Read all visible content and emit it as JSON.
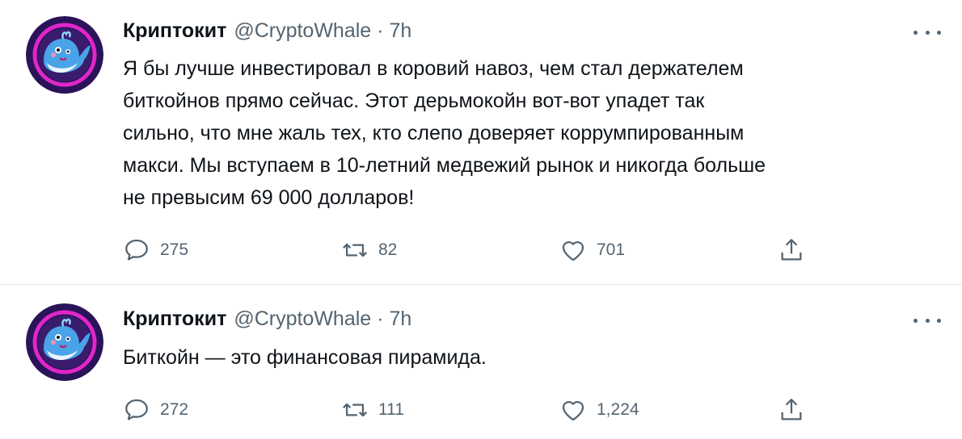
{
  "tweets": [
    {
      "author_name": "Криптокит",
      "handle": "@CryptoWhale",
      "separator": "·",
      "time": "7h",
      "text": "Я бы лучше инвестировал в коровий навоз, чем стал держателем\nбиткойнов прямо сейчас. Этот дерьмокойн вот-вот упадет так\nсильно, что мне жаль тех, кто слепо доверяет коррумпированным\nмакси. Мы вступаем в 10-летний медвежий рынок и никогда больше\nне превысим 69 000 долларов!",
      "replies": "275",
      "retweets": "82",
      "likes": "701"
    },
    {
      "author_name": "Криптокит",
      "handle": "@CryptoWhale",
      "separator": "·",
      "time": "7h",
      "text": "Биткойн — это финансовая пирамида.",
      "replies": "272",
      "retweets": "111",
      "likes": "1,224"
    }
  ],
  "icons": {
    "reply": "reply-icon",
    "retweet": "retweet-icon",
    "like": "like-icon",
    "share": "share-icon",
    "more": "more-icon",
    "avatar": "whale-avatar"
  },
  "colors": {
    "text_primary": "#0f1419",
    "text_secondary": "#536471",
    "divider": "#e1e8ed",
    "avatar_bg": "#2b1359",
    "avatar_ring": "#e026c9",
    "whale": "#4aa3e8"
  }
}
